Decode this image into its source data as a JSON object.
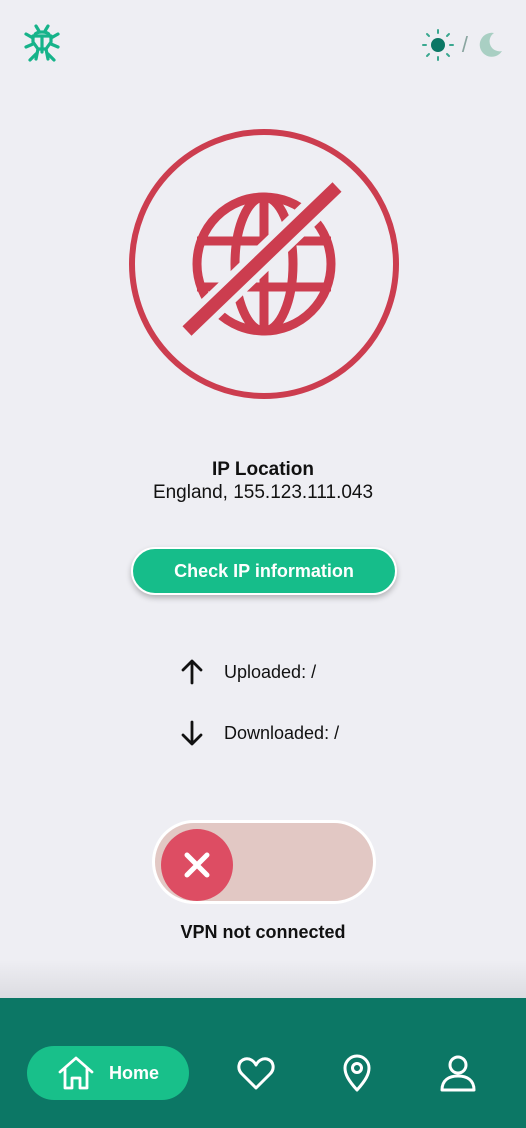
{
  "header": {
    "logo_icon": "bug-shield-icon",
    "theme_toggle": {
      "light_icon": "sun-icon",
      "separator": "/",
      "dark_icon": "moon-icon",
      "active": "light"
    }
  },
  "status_graphic": {
    "icon": "globe-crossed-icon",
    "color": "#cc3d4f"
  },
  "ip": {
    "title": "IP Location",
    "value": "England, 155.123.111.043"
  },
  "check_button": {
    "label": "Check IP information"
  },
  "stats": {
    "uploaded": {
      "icon": "arrow-up-icon",
      "label": "Uploaded: /"
    },
    "downloaded": {
      "icon": "arrow-down-icon",
      "label": "Downloaded: /"
    }
  },
  "vpn": {
    "connected": false,
    "status_text": "VPN not connected",
    "knob_icon": "close-icon"
  },
  "nav": {
    "items": [
      {
        "label": "Home",
        "icon": "home-icon",
        "active": true
      },
      {
        "label": "",
        "icon": "heart-icon",
        "active": false
      },
      {
        "label": "",
        "icon": "location-pin-icon",
        "active": false
      },
      {
        "label": "",
        "icon": "user-icon",
        "active": false
      }
    ]
  },
  "colors": {
    "accent": "#16bd8a",
    "nav_bg": "#0c7765",
    "danger": "#cc3d4f",
    "background": "#eeeef3"
  }
}
